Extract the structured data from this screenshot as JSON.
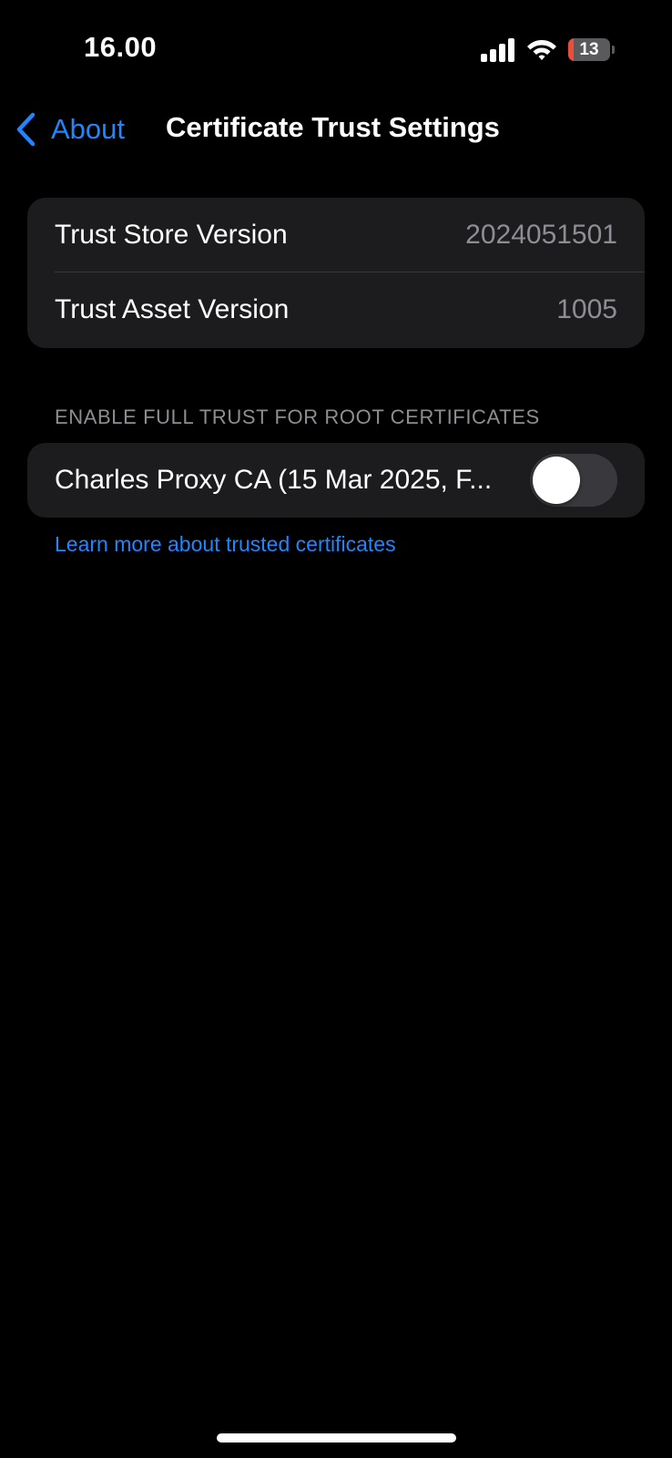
{
  "status_bar": {
    "time": "16.00",
    "battery_level": "13",
    "battery_fraction": 0.13,
    "signal_icon": "cellular-signal-icon",
    "wifi_icon": "wifi-icon"
  },
  "nav": {
    "back_label": "About",
    "back_icon": "chevron-left-icon",
    "title": "Certificate Trust Settings"
  },
  "versions": [
    {
      "label": "Trust Store Version",
      "value": "2024051501"
    },
    {
      "label": "Trust Asset Version",
      "value": "1005"
    }
  ],
  "certificates_section": {
    "header": "ENABLE FULL TRUST FOR ROOT CERTIFICATES",
    "items": [
      {
        "label": "Charles Proxy CA (15 Mar 2025, F...",
        "enabled": false
      }
    ]
  },
  "learn_more": "Learn more about trusted certificates",
  "colors": {
    "background": "#000000",
    "grouped_cell": "#1c1c1e",
    "accent": "#1f86ff",
    "secondary_text": "#8d8d93",
    "battery_low": "#eb4e3d"
  }
}
